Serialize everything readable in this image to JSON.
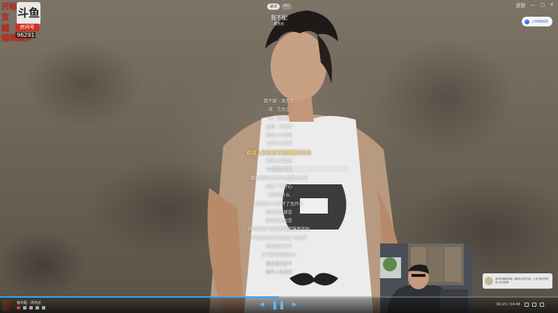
{
  "overlay": {
    "line1": "开站石粉丝",
    "line2": "支",
    "line3": "越",
    "line4": "越来越多",
    "logo_text": "斗鱼",
    "room_tag": "房间号",
    "room_id": "96291"
  },
  "header": {
    "tabs": [
      {
        "label": "歌词",
        "active": true
      },
      {
        "label": "MV",
        "active": false
      }
    ],
    "song_title": "我不配",
    "artist": "周杰伦"
  },
  "window_controls": [
    "皮肤",
    "—",
    "□",
    "✕"
  ],
  "ai_pill": {
    "label": "AI",
    "sub": "上传歌曲画面"
  },
  "lyrics": {
    "current_index": 6,
    "lines": [
      "我不配 - 周杰伦",
      "词：方文山",
      "曲：周杰伦",
      "编曲：林迈可",
      "还是上大路走",
      "大声从头开始",
      "原谅上你吉他节拍慢慢泛过去",
      "你睡上的我事",
      "有这里在花间",
      "我的青春也开始为爱情泛过来",
      "但是丁不开心",
      "又那是什么",
      "你想要什么打开了也开心",
      "相信你的感受",
      "原谅是你也受",
      "所有的都不是能发现我慢要开始",
      "不用没有大别不是着了的样子",
      "我已经放开手",
      "你可能在说我多么",
      "我还是已经不",
      "我的人生是否"
    ]
  },
  "notification": {
    "text": "周杰伦最新单曲《最伟大的作品》上线 快来听听吧 点击查看"
  },
  "player": {
    "now_playing": "我不配 - 周杰伦",
    "progress_fraction": 0.5,
    "time": "00:23 / 04:48",
    "controls": {
      "prev": "◀",
      "play_pause": "❚❚",
      "next": "▶"
    }
  },
  "colors": {
    "accent": "#36a6ff",
    "current_lyric": "#f2d27a",
    "overlay_red": "#e03020"
  }
}
